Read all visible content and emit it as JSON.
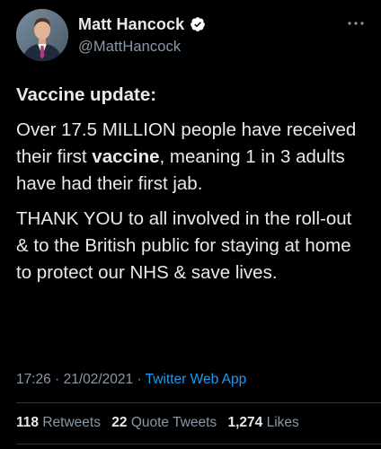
{
  "author": {
    "display_name": "Matt Hancock",
    "handle": "@MattHancock",
    "verified": true,
    "verified_icon": "verified-badge-icon"
  },
  "more_icon": "more-horizontal-icon",
  "tweet": {
    "title": "Vaccine update",
    "title_suffix": ":",
    "p1_before": "Over 17.5 MILLION people have received their first ",
    "p1_bold": "vaccine",
    "p1_after": ", meaning 1 in 3 adults have had their first jab.",
    "p2": "THANK YOU to all involved in the roll-out & to the British public for staying at home to protect our NHS & save lives."
  },
  "meta": {
    "time": "17:26",
    "separator": " · ",
    "date": "21/02/2021",
    "separator2": " · ",
    "source": "Twitter Web App"
  },
  "stats": {
    "retweets_count": "118",
    "retweets_label": "Retweets",
    "quotes_count": "22",
    "quotes_label": "Quote Tweets",
    "likes_count": "1,274",
    "likes_label": "Likes"
  },
  "colors": {
    "background": "#000000",
    "text": "#e7e9ea",
    "secondary": "#8b98a5",
    "link": "#1d9bf0",
    "divider": "#2f3336"
  }
}
